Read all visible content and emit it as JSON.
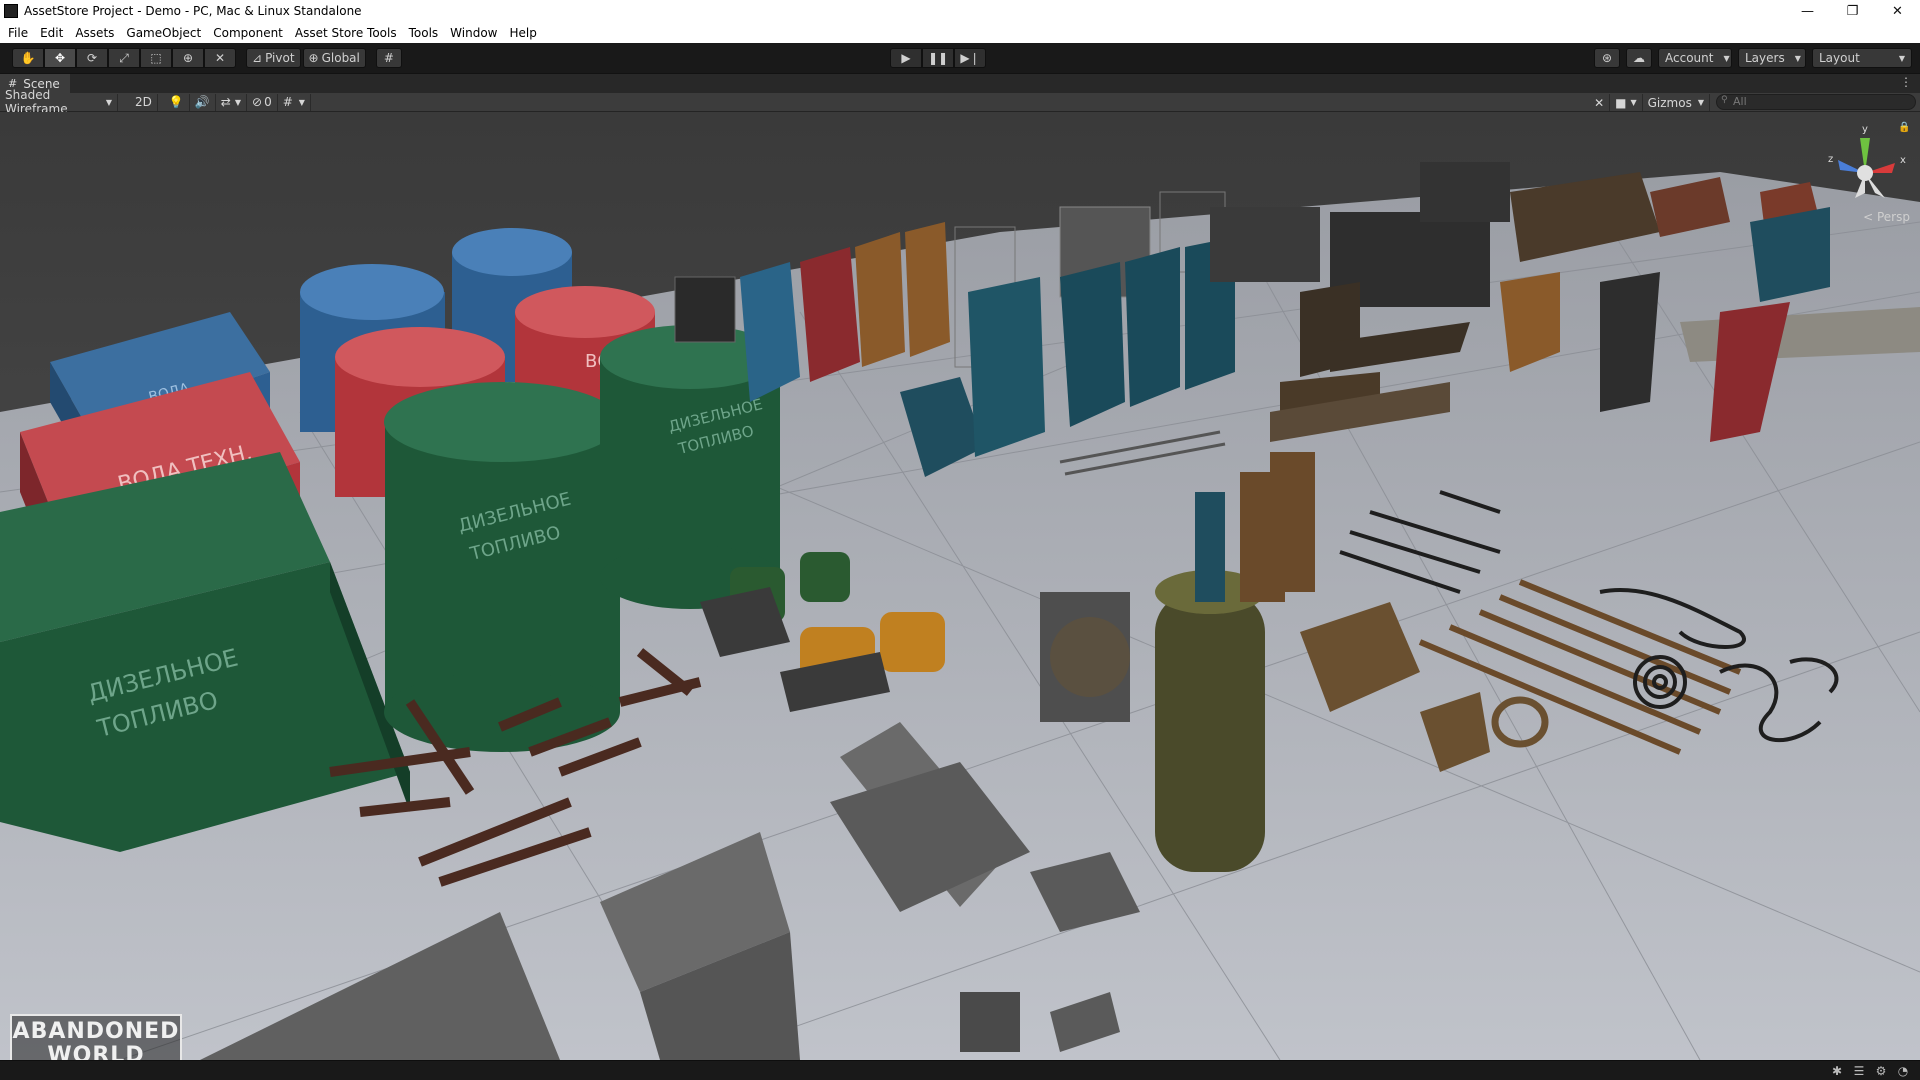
{
  "window": {
    "title": "AssetStore Project - Demo - PC, Mac & Linux Standalone",
    "controls": {
      "minimize": "—",
      "restore": "❐",
      "close": "✕"
    }
  },
  "menu": [
    "File",
    "Edit",
    "Assets",
    "GameObject",
    "Component",
    "Asset Store Tools",
    "Tools",
    "Window",
    "Help"
  ],
  "toolbar": {
    "tools": [
      "hand-tool-icon",
      "move-tool-icon",
      "rotate-tool-icon",
      "scale-tool-icon",
      "rect-tool-icon",
      "transform-tool-icon",
      "custom-tool-icon"
    ],
    "pivot_label": "Pivot",
    "global_label": "Global",
    "account_label": "Account",
    "layers_label": "Layers",
    "layout_label": "Layout"
  },
  "scene": {
    "tab_label": "Scene",
    "shading_mode": "Shaded Wireframe",
    "mode_2d": "2D",
    "hidden_count": "0",
    "gizmos_label": "Gizmos",
    "search_placeholder": "All",
    "projection_label": "< Persp",
    "axis_labels": {
      "x": "x",
      "y": "y",
      "z": "z"
    }
  },
  "assets_text": {
    "tank_blue": "ВОДА",
    "tank_red": "ВОДА ТЕХН.",
    "tank_green_line1": "ДИЗЕЛЬНОЕ",
    "tank_green_line2": "ТОПЛИВО",
    "barrel_red": "ВОД",
    "barrel_green_line1": "ДИЗЕЛЬНОЕ",
    "barrel_green_line2": "ТОПЛИВО"
  },
  "logo": {
    "line1": "ABANDONED",
    "line2": "WORLD"
  },
  "colors": {
    "editor_dark": "#191919",
    "panel": "#3c3c3c",
    "ground": "#b9bcc3",
    "tank_blue": "#2d5f91",
    "tank_red": "#b2353b",
    "tank_green": "#1e5838"
  }
}
